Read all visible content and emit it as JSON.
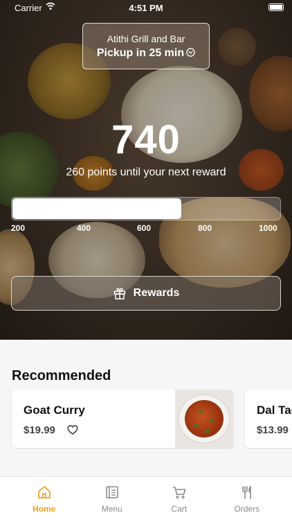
{
  "status_bar": {
    "carrier": "Carrier",
    "time": "4:51 PM"
  },
  "restaurant": {
    "name": "Atithi Grill and Bar",
    "pickup": "Pickup in 25 min"
  },
  "rewards": {
    "points": "740",
    "subtitle": "260 points until your next reward",
    "progress_fraction": 0.63,
    "ticks": [
      "200",
      "400",
      "600",
      "800",
      "1000"
    ],
    "button_label": "Rewards"
  },
  "recommended": {
    "title": "Recommended",
    "items": [
      {
        "name": "Goat Curry",
        "price": "$19.99"
      },
      {
        "name": "Dal Tadka",
        "price": "$13.99"
      }
    ]
  },
  "tabs": [
    {
      "label": "Home",
      "icon": "home-icon",
      "active": true
    },
    {
      "label": "Menu",
      "icon": "menu-icon",
      "active": false
    },
    {
      "label": "Cart",
      "icon": "cart-icon",
      "active": false
    },
    {
      "label": "Orders",
      "icon": "orders-icon",
      "active": false
    }
  ],
  "colors": {
    "accent": "#f0a020",
    "inactive": "#8a8a8a"
  }
}
